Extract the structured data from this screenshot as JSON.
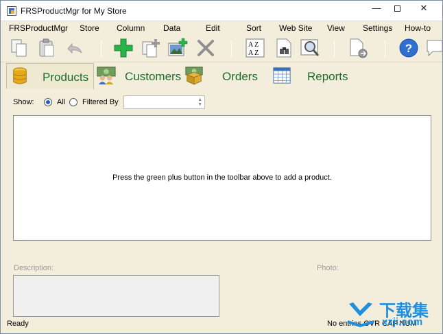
{
  "window": {
    "title": "FRSProductMgr for My Store",
    "minimize_glyph": "—",
    "close_glyph": "✕"
  },
  "menu": [
    {
      "label": "FRSProductMgr"
    },
    {
      "label": "Store"
    },
    {
      "label": "Column"
    },
    {
      "label": "Data"
    },
    {
      "label": "Edit"
    },
    {
      "label": "Sort"
    },
    {
      "label": "Web Site"
    },
    {
      "label": "View"
    },
    {
      "label": "Settings"
    },
    {
      "label": "How-to"
    }
  ],
  "toolbar": {
    "icons": [
      "copy-icon",
      "paste-icon",
      "undo-icon",
      "add-product-icon",
      "duplicate-icon",
      "add-photo-icon",
      "delete-icon",
      "sort-az-icon",
      "find-icon",
      "zoom-photo-icon",
      "export-icon",
      "help-icon",
      "chat-icon"
    ],
    "sort_az": "A Z"
  },
  "tabs": [
    {
      "label": "Products",
      "icon": "database-icon",
      "active": true
    },
    {
      "label": "Customers",
      "icon": "customers-icon",
      "active": false
    },
    {
      "label": "Orders",
      "icon": "orders-icon",
      "active": false
    },
    {
      "label": "Reports",
      "icon": "reports-icon",
      "active": false
    }
  ],
  "filter": {
    "show_label": "Show:",
    "all_label": "All",
    "filtered_by_label": "Filtered By",
    "selected": "All",
    "filter_value": ""
  },
  "list": {
    "empty_message": "Press the green plus button in the toolbar above to add a product."
  },
  "details": {
    "description_label": "Description:",
    "photo_label": "Photo:",
    "description_value": ""
  },
  "status": {
    "left": "Ready",
    "right": "No entries   OVR  CAP  NUM"
  },
  "watermark": {
    "text": "下载集",
    "sub": "xzji.com"
  },
  "colors": {
    "background": "#f3eedc",
    "tab_text": "#1b6c2c",
    "add_green": "#2bb34a",
    "help_blue": "#2e6fd1",
    "watermark_blue": "#1f8fe0"
  }
}
